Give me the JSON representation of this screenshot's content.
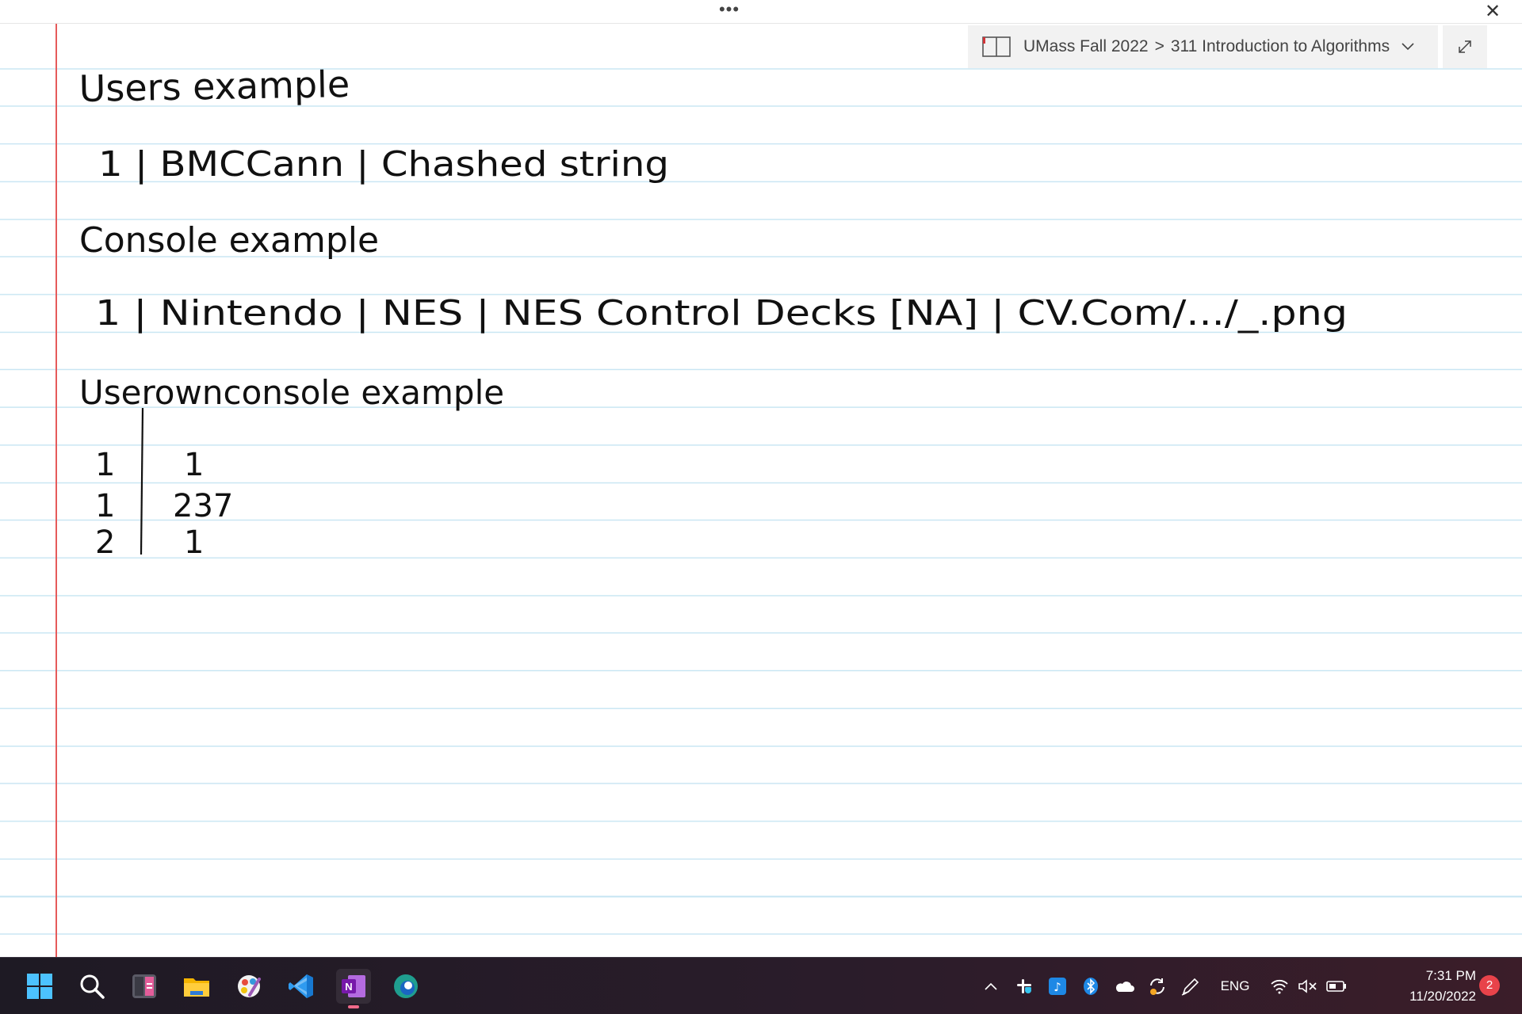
{
  "window": {
    "more_glyph": "•••",
    "close_glyph": "✕"
  },
  "breadcrumb": {
    "notebook": "UMass Fall 2022",
    "separator": ">",
    "section": "311 Introduction to Algorithms"
  },
  "notes": {
    "users_heading": "Users example",
    "users_row": "1 | BMCCann | Chashed string",
    "console_heading": "Console example",
    "console_row": "1 | Nintendo | NES | NES Control Decks [NA] | CV.Com/.../_.png",
    "userownconsole_heading": "Userownconsole example",
    "uoc_rows": [
      {
        "user_id": "1",
        "console_id": "1"
      },
      {
        "user_id": "1",
        "console_id": "237"
      },
      {
        "user_id": "2",
        "console_id": "1"
      }
    ]
  },
  "taskbar": {
    "pinned": [
      {
        "name": "start-icon"
      },
      {
        "name": "search-icon"
      },
      {
        "name": "calculator-icon"
      },
      {
        "name": "file-explorer-icon"
      },
      {
        "name": "paint-app-icon"
      },
      {
        "name": "vscode-icon"
      },
      {
        "name": "onenote-icon",
        "active": true
      },
      {
        "name": "edge-icon"
      }
    ],
    "tray": {
      "language": "ENG",
      "time": "7:31 PM",
      "date": "11/20/2022",
      "notification_count": "2"
    }
  }
}
